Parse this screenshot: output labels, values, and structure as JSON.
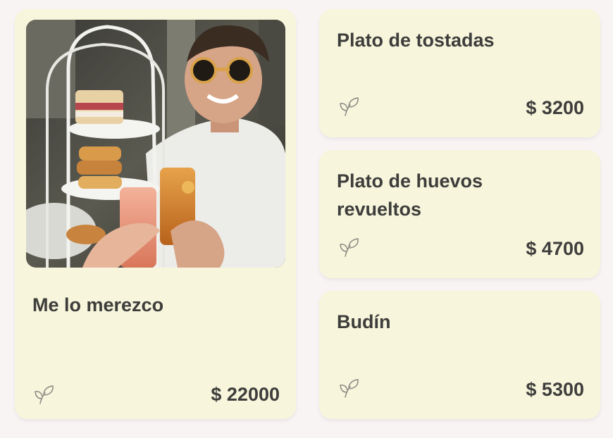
{
  "products": [
    {
      "title": "Me lo merezco",
      "price": "$ 22000",
      "icon": "leaf-icon",
      "has_image": true
    },
    {
      "title": "Plato de tostadas",
      "price": "$ 3200",
      "icon": "leaf-icon"
    },
    {
      "title": "Plato de huevos revueltos",
      "price": "$ 4700",
      "icon": "leaf-icon"
    },
    {
      "title": "Budín",
      "price": "$ 5300",
      "icon": "leaf-icon"
    }
  ],
  "colors": {
    "background": "#f8f4f4",
    "card": "#f7f5dc",
    "text": "#3d3d3b",
    "icon": "#8a8a82"
  }
}
